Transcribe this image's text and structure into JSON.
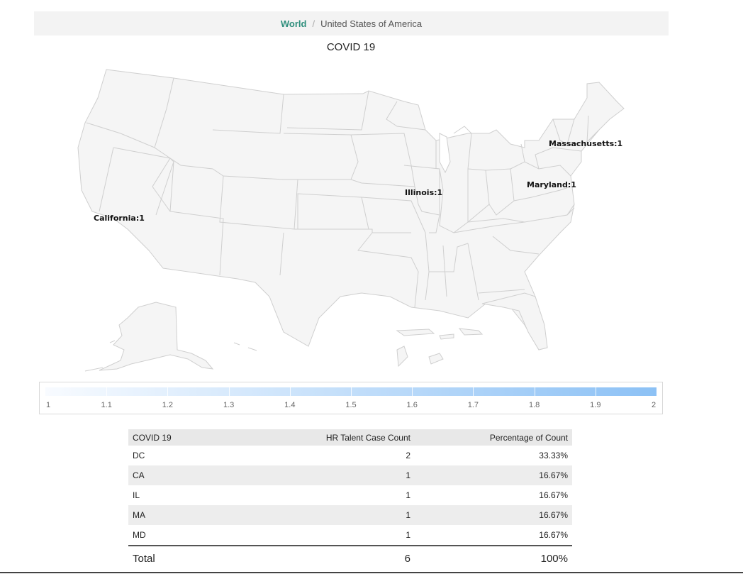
{
  "breadcrumb": {
    "world": "World",
    "current": "United States of America"
  },
  "map": {
    "title": "COVID 19",
    "labels": [
      {
        "name": "California",
        "code": "CA",
        "value": 1,
        "text": "California:1"
      },
      {
        "name": "Illinois",
        "code": "IL",
        "value": 1,
        "text": "Illinois:1"
      },
      {
        "name": "Maryland",
        "code": "MD",
        "value": 1,
        "text": "Maryland:1"
      },
      {
        "name": "Massachusetts",
        "code": "MA",
        "value": 1,
        "text": "Massachusetts:1"
      }
    ],
    "fill_color": "#f5f5f5",
    "border_color": "#cfcfcf"
  },
  "legend": {
    "min": 1,
    "max": 2,
    "ticks": [
      "1",
      "1.1",
      "1.2",
      "1.3",
      "1.4",
      "1.5",
      "1.6",
      "1.7",
      "1.8",
      "1.9",
      "2"
    ],
    "color_low": "#f8fbff",
    "color_high": "#8cc1f5"
  },
  "table": {
    "headers": [
      "COVID 19",
      "HR Talent Case Count",
      "Percentage of Count"
    ],
    "rows": [
      [
        "DC",
        "2",
        "33.33%"
      ],
      [
        "CA",
        "1",
        "16.67%"
      ],
      [
        "IL",
        "1",
        "16.67%"
      ],
      [
        "MA",
        "1",
        "16.67%"
      ],
      [
        "MD",
        "1",
        "16.67%"
      ]
    ],
    "total": [
      "Total",
      "6",
      "100%"
    ]
  }
}
